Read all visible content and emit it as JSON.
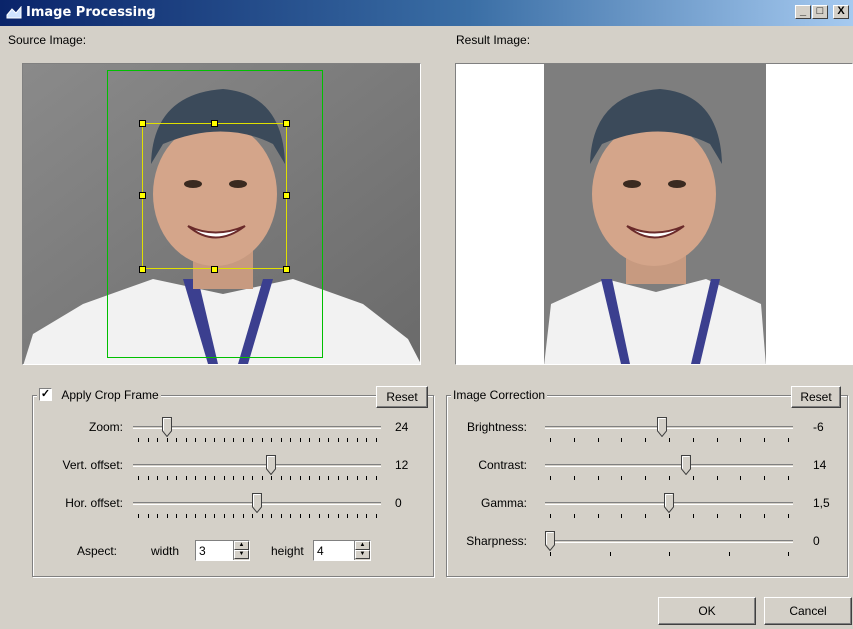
{
  "window": {
    "title": "Image Processing",
    "minimize": "_",
    "maximize": "□",
    "close": "X"
  },
  "source": {
    "label": "Source Image:"
  },
  "result": {
    "label": "Result Image:"
  },
  "crop": {
    "checkbox_label": "Apply Crop Frame",
    "checked": "✓",
    "reset": "Reset",
    "sliders": [
      {
        "label": "Zoom:",
        "value": "24",
        "position": 0.12,
        "ticks": 26
      },
      {
        "label": "Vert. offset:",
        "value": "12",
        "position": 0.56,
        "ticks": 26
      },
      {
        "label": "Hor. offset:",
        "value": "0",
        "position": 0.5,
        "ticks": 26
      }
    ],
    "aspect_label": "Aspect:",
    "width_label": "width",
    "width_value": "3",
    "height_label": "height",
    "height_value": "4"
  },
  "correction": {
    "title": "Image Correction",
    "reset": "Reset",
    "sliders": [
      {
        "label": "Brightness:",
        "value": "-6",
        "position": 0.47,
        "ticks": 11
      },
      {
        "label": "Contrast:",
        "value": "14",
        "position": 0.57,
        "ticks": 11
      },
      {
        "label": "Gamma:",
        "value": "1,5",
        "position": 0.5,
        "ticks": 11
      },
      {
        "label": "Sharpness:",
        "value": "0",
        "position": 0.0,
        "ticks": 5
      }
    ]
  },
  "buttons": {
    "ok": "OK",
    "cancel": "Cancel"
  },
  "icons": [
    "app-icon",
    "minimize-icon",
    "maximize-icon",
    "close-icon",
    "checkmark-icon",
    "spin-up-icon",
    "spin-down-icon"
  ]
}
